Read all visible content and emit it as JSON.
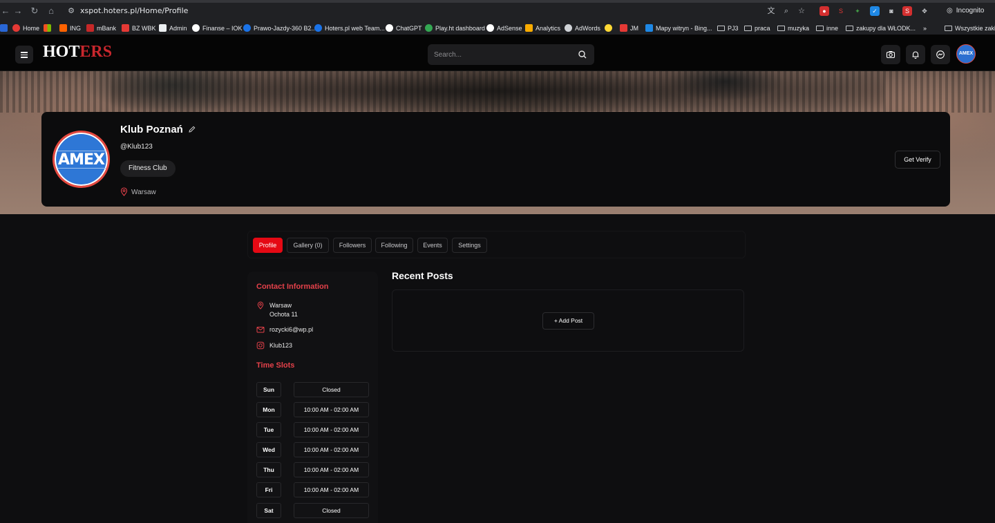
{
  "browser": {
    "url": "xspot.hoters.pl/Home/Profile",
    "incognito_label": "Incognito",
    "bookmarks": [
      {
        "label": "Home"
      },
      {
        "label": ""
      },
      {
        "label": "ING"
      },
      {
        "label": "mBank"
      },
      {
        "label": "BZ WBK"
      },
      {
        "label": "Admin"
      },
      {
        "label": "Finanse – IOK"
      },
      {
        "label": "Prawo-Jazdy-360 B2..."
      },
      {
        "label": "Hoters.pl web Team..."
      },
      {
        "label": "ChatGPT"
      },
      {
        "label": "Play.ht dashboard"
      },
      {
        "label": "AdSense"
      },
      {
        "label": "Analytics"
      },
      {
        "label": "AdWords"
      },
      {
        "label": ""
      },
      {
        "label": "JM"
      },
      {
        "label": "Mapy witryn - Bing..."
      },
      {
        "label": "PJ3"
      },
      {
        "label": "praca"
      },
      {
        "label": "muzyka"
      },
      {
        "label": "inne"
      },
      {
        "label": "zakupy dla WŁODK..."
      },
      {
        "label": "»"
      },
      {
        "label": "Wszystkie zakła"
      }
    ]
  },
  "header": {
    "logo_text_a": "HO",
    "logo_text_b": "T",
    "logo_text_c": "ERS",
    "search_placeholder": "Search...",
    "avatar_text": "AMEX"
  },
  "profile": {
    "avatar_text": "AMEX",
    "name": "Klub Poznań",
    "handle": "@Klub123",
    "category": "Fitness Club",
    "location": "Warsaw",
    "verify_label": "Get Verify"
  },
  "tabs": [
    {
      "label": "Profile"
    },
    {
      "label": "Gallery (0)"
    },
    {
      "label": "Followers"
    },
    {
      "label": "Following"
    },
    {
      "label": "Events"
    },
    {
      "label": "Settings"
    }
  ],
  "contact": {
    "title": "Contact Information",
    "address_line1": "Warsaw",
    "address_line2": "Ochota 11",
    "email": "rozycki6@wp.pl",
    "instagram": "Klub123"
  },
  "time_slots": {
    "title": "Time Slots",
    "rows": [
      {
        "day": "Sun",
        "hours": "Closed"
      },
      {
        "day": "Mon",
        "hours": "10:00 AM - 02:00 AM"
      },
      {
        "day": "Tue",
        "hours": "10:00 AM - 02:00 AM"
      },
      {
        "day": "Wed",
        "hours": "10:00 AM - 02:00 AM"
      },
      {
        "day": "Thu",
        "hours": "10:00 AM - 02:00 AM"
      },
      {
        "day": "Fri",
        "hours": "10:00 AM - 02:00 AM"
      },
      {
        "day": "Sat",
        "hours": "Closed"
      }
    ]
  },
  "recent_posts": {
    "title": "Recent Posts",
    "add_post_label": "Add Post"
  },
  "colors": {
    "accent": "#e50914",
    "section_title": "#e5414a",
    "background": "#0e0e10"
  }
}
